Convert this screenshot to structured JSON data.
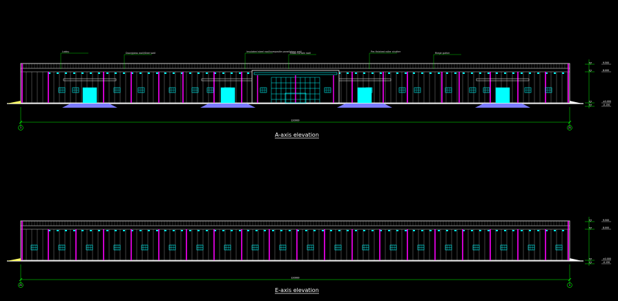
{
  "elevations": [
    {
      "title": "A-axis elevation",
      "annotations": [
        "Lobby",
        "Door/glass wall/Steel wall",
        "Insulated steel roof/composite panel/glass wall",
        "Glass curtain wall",
        "Pre-finished roller shutter",
        "Ridge gutter"
      ],
      "dimension_label": "120000",
      "axis_start": "1",
      "axis_end": "21",
      "level_marks": [
        "9.500",
        "8.000",
        "±0.000",
        "-0.150"
      ]
    },
    {
      "title": "E-axis elevation",
      "dimension_label": "120000",
      "axis_start": "21",
      "axis_end": "1",
      "level_marks": [
        "9.500",
        "8.000",
        "±0.000",
        "-0.150"
      ]
    }
  ],
  "colors": {
    "background": "#000000",
    "outline": "#ffffff",
    "column": "#ff00ff",
    "window": "#00ffff",
    "ground": "#7c7cff",
    "dimension": "#00ff00",
    "leader": "#00ff00"
  }
}
